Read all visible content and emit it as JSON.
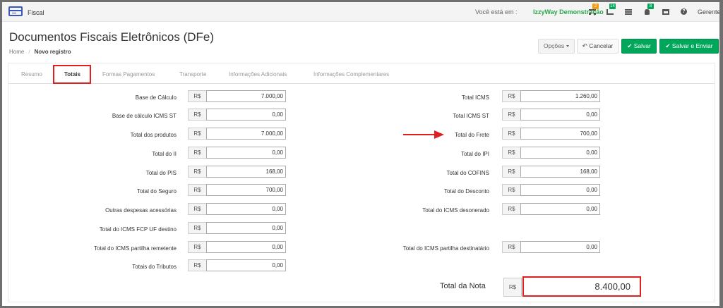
{
  "app": {
    "name": "Fiscal"
  },
  "topbar": {
    "you_are_in": "Você está em :",
    "company": "IzzyWay Demonstração",
    "badges": [
      "2",
      "14",
      "8"
    ],
    "badge_colors": [
      "#f39c12",
      "#00a65a",
      "#00a65a"
    ],
    "user": "Gerente"
  },
  "page": {
    "title": "Documentos Fiscais Eletrônicos (DFe)"
  },
  "breadcrumb": {
    "home": "Home",
    "sep": "/",
    "current": "Novo registro"
  },
  "toolbar": {
    "opcoes": "Opções",
    "cancelar": "Cancelar",
    "salvar": "Salvar",
    "salvar_enviar": "Salvar e Enviar"
  },
  "tabs": [
    "Resumo",
    "Totais",
    "Formas Pagamentos",
    "Transporte",
    "Informações Adicionais",
    "Informações Complementares"
  ],
  "active_tab": "Totais",
  "currency": "R$",
  "left_fields": [
    {
      "label": "Base de Cálculo",
      "value": "7.000,00"
    },
    {
      "label": "Base de cálculo ICMS ST",
      "value": "0,00"
    },
    {
      "label": "Total dos produtos",
      "value": "7.000,00"
    },
    {
      "label": "Total do II",
      "value": "0,00"
    },
    {
      "label": "Total do PIS",
      "value": "168,00"
    },
    {
      "label": "Total do Seguro",
      "value": "700,00"
    },
    {
      "label": "Outras despesas acessórias",
      "value": "0,00"
    },
    {
      "label": "Total do ICMS FCP UF destino",
      "value": "0,00"
    },
    {
      "label": "Total do ICMS partilha remetente",
      "value": "0,00"
    },
    {
      "label": "Totais do Tributos",
      "value": "0,00"
    }
  ],
  "right_fields": [
    {
      "label": "Total ICMS",
      "value": "1.260,00"
    },
    {
      "label": "Total ICMS ST",
      "value": "0,00"
    },
    {
      "label": "Total do Frete",
      "value": "700,00"
    },
    {
      "label": "Total do IPI",
      "value": "0,00"
    },
    {
      "label": "Total do COFINS",
      "value": "168,00"
    },
    {
      "label": "Total do Desconto",
      "value": "0,00"
    },
    {
      "label": "Total do ICMS desonerado",
      "value": "0,00"
    },
    {
      "label": "Total do ICMS partilha destinatário",
      "value": "0,00"
    }
  ],
  "total": {
    "label": "Total da Nota",
    "value": "8.400,00"
  },
  "colors": {
    "brand": "#3b56b8",
    "success": "#00a65a",
    "highlight": "#e02020",
    "company": "#2aa64b"
  }
}
